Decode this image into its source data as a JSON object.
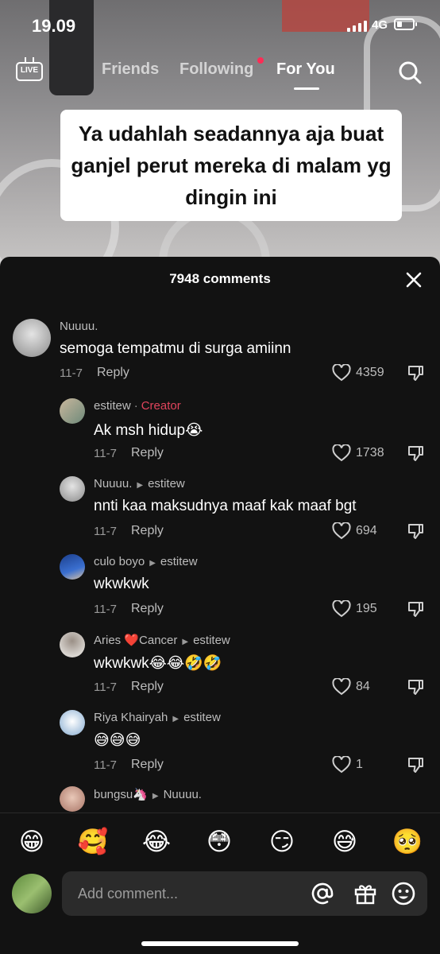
{
  "status_bar": {
    "time": "19.09",
    "network": "4G"
  },
  "top_nav": {
    "tabs": [
      "Friends",
      "Following",
      "For You"
    ],
    "active_tab": "For You",
    "live_label": "LIVE"
  },
  "video": {
    "caption": "Ya udahlah seadannya aja buat ganjel perut mereka di malam yg dingin ini"
  },
  "comments_sheet": {
    "title": "7948 comments",
    "comments": [
      {
        "author": "Nuuuu.",
        "reply_to": "",
        "tag": "",
        "text": "semoga tempatmu di surga amiinn",
        "date": "11-7",
        "reply_label": "Reply",
        "likes": "4359"
      },
      {
        "author": "estitew",
        "reply_to": "",
        "tag": "Creator",
        "text": "Ak msh hidup😭",
        "date": "11-7",
        "reply_label": "Reply",
        "likes": "1738"
      },
      {
        "author": "Nuuuu.",
        "reply_to": "estitew",
        "tag": "",
        "text": "nnti kaa maksudnya maaf kak maaf bgt",
        "date": "11-7",
        "reply_label": "Reply",
        "likes": "694"
      },
      {
        "author": "culo boyo",
        "reply_to": "estitew",
        "tag": "",
        "text": "wkwkwk",
        "date": "11-7",
        "reply_label": "Reply",
        "likes": "195"
      },
      {
        "author": "Aries ❤️Cancer",
        "reply_to": "estitew",
        "tag": "",
        "text": "wkwkwk😂😂🤣🤣",
        "date": "11-7",
        "reply_label": "Reply",
        "likes": "84"
      },
      {
        "author": "Riya Khairyah",
        "reply_to": "estitew",
        "tag": "",
        "text": "😅😅😅",
        "date": "11-7",
        "reply_label": "Reply",
        "likes": "1"
      },
      {
        "author": "bungsu🦄",
        "reply_to": "Nuuuu.",
        "tag": "",
        "text": "",
        "date": "",
        "reply_label": "",
        "likes": ""
      }
    ]
  },
  "emoji_bar": [
    "😁",
    "🥰",
    "😂",
    "😳",
    "😏",
    "😅",
    "🥺"
  ],
  "comment_input": {
    "placeholder": "Add comment..."
  },
  "colors": {
    "sheet_bg": "#121212",
    "creator_tag": "#e0445c",
    "notification_dot": "#fe2c55"
  }
}
